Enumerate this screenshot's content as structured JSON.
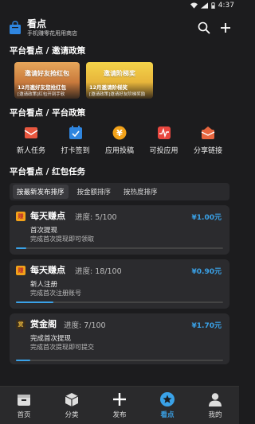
{
  "status_bar": {
    "time": "4:37"
  },
  "header": {
    "app_name": "看点",
    "slogan": "手机赚零花用用商店"
  },
  "sections": {
    "invite_title": "平台看点 / 邀请政策",
    "platform_title": "平台看点 / 平台政策",
    "redpack_title": "平台看点 / 红包任务"
  },
  "banners": [
    {
      "art_text": "邀请好友抢红包",
      "title": "12月邀好友您抢红包",
      "subtitle": "[邀请政策]红包开到手软"
    },
    {
      "art_text": "邀请阶梯奖",
      "title": "12月邀请阶梯奖",
      "subtitle": "[邀请政策]邀请好友阶梯奖励"
    }
  ],
  "actions": [
    {
      "label": "新人任务",
      "icon": "gift-icon",
      "color": "#e8573f"
    },
    {
      "label": "打卡签到",
      "icon": "calendar-check-icon",
      "color": "#2f86e0"
    },
    {
      "label": "应用投稿",
      "icon": "yen-coin-icon",
      "color": "#f2a219"
    },
    {
      "label": "可投应用",
      "icon": "pulse-icon",
      "color": "#e8473f"
    },
    {
      "label": "分享链接",
      "icon": "share-envelope-icon",
      "color": "#e8663f"
    }
  ],
  "sort": {
    "options": [
      "按最新发布排序",
      "按金额排序",
      "按热度排序"
    ],
    "active": "按最新发布排序"
  },
  "tasks": [
    {
      "name": "每天赚点",
      "progress_text": "进度: 5/100",
      "progress": 0.05,
      "reward": "¥1.00元",
      "step": "首次提现",
      "desc": "完成首次提现即可领取"
    },
    {
      "name": "每天赚点",
      "progress_text": "进度: 18/100",
      "progress": 0.18,
      "reward": "¥0.90元",
      "step": "新人注册",
      "desc": "完成首次注册账号"
    },
    {
      "name": "赏金阁",
      "progress_text": "进度: 7/100",
      "progress": 0.07,
      "reward": "¥1.70元",
      "step": "完成首次提现",
      "desc": "完成首次提现即可提交"
    }
  ],
  "tabbar": {
    "items": [
      {
        "label": "首页",
        "icon": "home-box-icon"
      },
      {
        "label": "分类",
        "icon": "cube-icon"
      },
      {
        "label": "发布",
        "icon": "plus-icon"
      },
      {
        "label": "看点",
        "icon": "star-badge-icon"
      },
      {
        "label": "我的",
        "icon": "person-icon"
      }
    ],
    "active": "看点"
  },
  "colors": {
    "accent": "#3aa2e8",
    "background": "#1c1c1e",
    "card": "#2b2b2e"
  }
}
